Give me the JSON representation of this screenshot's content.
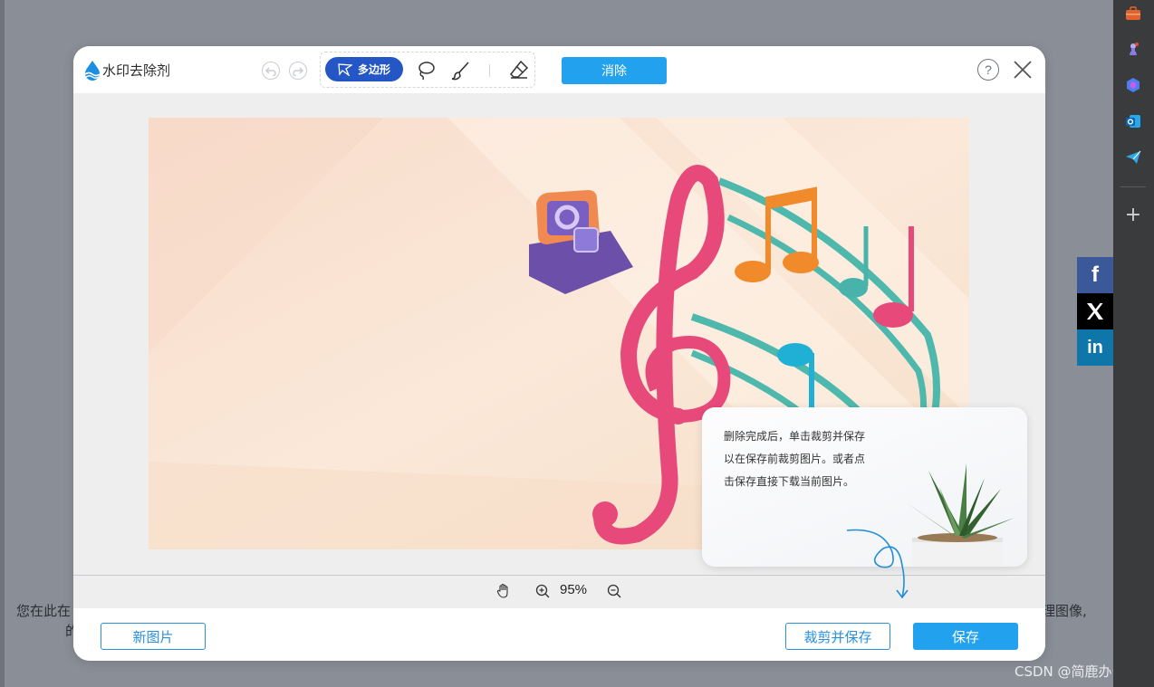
{
  "app": {
    "title": "水印去除剂"
  },
  "toolbar": {
    "undo_icon": "undo-icon",
    "redo_icon": "redo-icon",
    "polygon_label": "多边形",
    "lasso_icon": "lasso-icon",
    "brush_icon": "brush-icon",
    "eraser_icon": "eraser-icon",
    "erase_label": "消除",
    "help_label": "?",
    "close_icon": "close-icon"
  },
  "zoom": {
    "level": "95%"
  },
  "footer": {
    "new_image_label": "新图片",
    "crop_save_label": "裁剪并保存",
    "save_label": "保存"
  },
  "tip": {
    "lines": [
      "删除完成后，单击裁剪并保存",
      "以在保存前裁剪图片。或者点",
      "击保存直接下载当前图片。"
    ]
  },
  "background_page": {
    "left_text_1": "您在此在",
    "left_text_2": "的",
    "right_text": "理图像,",
    "watermark": "CSDN @简鹿办公"
  },
  "colors": {
    "accent": "#22a1ee",
    "polygon_active": "#2456c6",
    "outline_button": "#2a8fd8"
  }
}
